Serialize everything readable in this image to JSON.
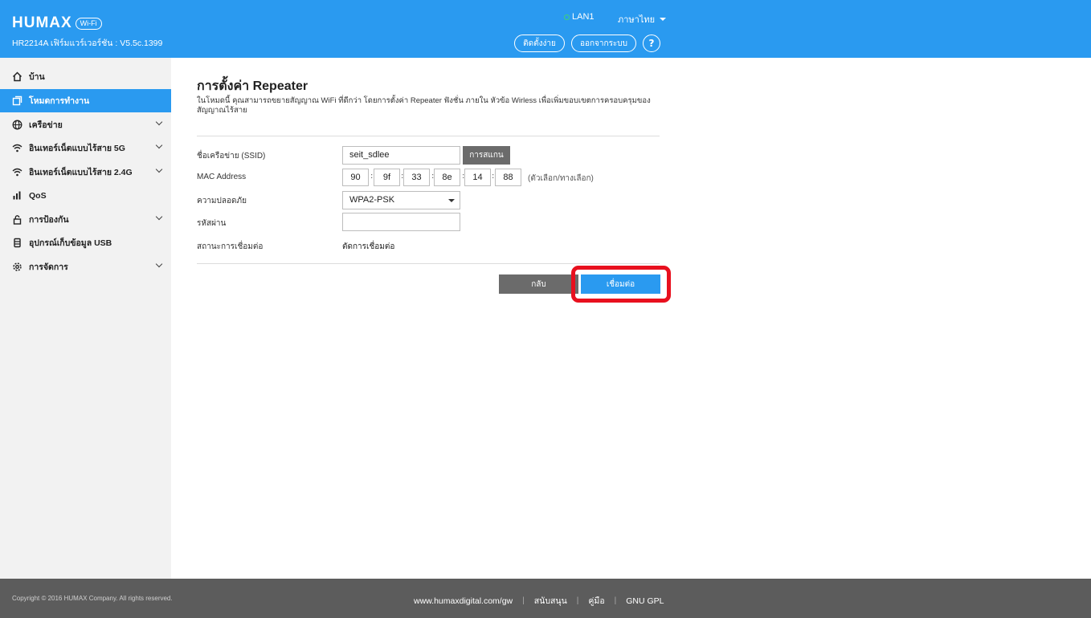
{
  "header": {
    "logo_text": "HUMAX",
    "logo_badge": "Wi-Fi",
    "firmware": "HR2214A เฟิร์มแวร์เวอร์ชัน : V5.5c.1399",
    "lan_status": "LAN1",
    "language": "ภาษาไทย",
    "setup_button": "ติดตั้งง่าย",
    "logout_button": "ออกจากระบบ",
    "help_button": "?"
  },
  "sidebar": {
    "items": [
      {
        "label": "บ้าน",
        "icon": "home-icon"
      },
      {
        "label": "โหมดการทำงาน",
        "icon": "copy-icon"
      },
      {
        "label": "เครือข่าย",
        "icon": "globe-icon"
      },
      {
        "label": "อินเทอร์เน็ตแบบไร้สาย 5G",
        "icon": "wifi-icon"
      },
      {
        "label": "อินเทอร์เน็ตแบบไร้สาย 2.4G",
        "icon": "wifi-icon"
      },
      {
        "label": "QoS",
        "icon": "bar-chart-icon"
      },
      {
        "label": "การป้องกัน",
        "icon": "lock-icon"
      },
      {
        "label": "อุปกรณ์เก็บข้อมูล USB",
        "icon": "usb-storage-icon"
      },
      {
        "label": "การจัดการ",
        "icon": "gear-icon"
      }
    ]
  },
  "main": {
    "title": "การตั้งค่า Repeater",
    "description": "ในโหมดนี้ คุณสามารถขยายสัญญาณ WiFi ที่ดีกว่า โดยการตั้งค่า Repeater ฟังชั่น ภายใน หัวข้อ Wirless เพื่อเพิ่มขอบเขตการครอบครุมของสัญญาณไร้สาย",
    "form": {
      "ssid_label": "ชื่อเครือข่าย (SSID)",
      "ssid_value": "seit_sdlee",
      "scan_button": "การสแกน",
      "mac_label": "MAC Address",
      "mac_octets": [
        "90",
        "9f",
        "33",
        "8e",
        "14",
        "88"
      ],
      "mac_hint": "(ตัวเลือก/ทางเลือก)",
      "security_label": "ความปลอดภัย",
      "security_value": "WPA2-PSK",
      "password_label": "รหัสผ่าน",
      "password_value": "",
      "status_label": "สถานะการเชื่อมต่อ",
      "status_value": "ตัดการเชื่อมต่อ"
    },
    "back_button": "กลับ",
    "connect_button": "เชื่อมต่อ"
  },
  "footer": {
    "copyright": "Copyright © 2016 HUMAX Company. All rights reserved.",
    "links": [
      "www.humaxdigital.com/gw",
      "สนับสนุน",
      "คู่มือ",
      "GNU GPL"
    ]
  },
  "colors": {
    "primary": "#2a9af0",
    "highlight": "#e8101e",
    "secondary_button": "#6b6b6b",
    "footer": "#5c5c5c"
  }
}
